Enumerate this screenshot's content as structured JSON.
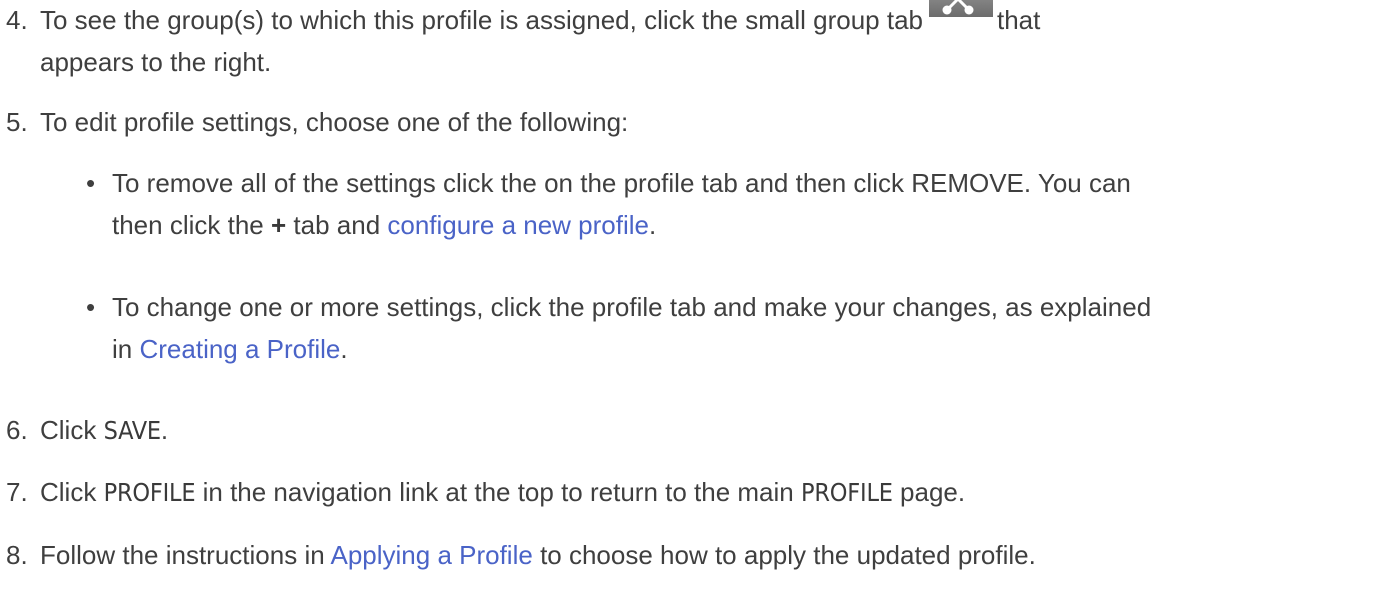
{
  "steps": {
    "s4": {
      "num": "4.",
      "pre": "To see the group(s) to which this profile is assigned, click the small group tab",
      "post": "that",
      "line2": "appears to the right."
    },
    "s5": {
      "num": "5.",
      "text": "To edit profile settings, choose one of the following:",
      "bullets": [
        {
          "dot": "•",
          "pre": "To remove all of the settings click the on the profile tab and then click REMOVE. You can",
          "line2_pre": "then click the",
          "plus": "+",
          "line2_mid": "tab and",
          "link": "configure a new profile",
          "line2_post": "."
        },
        {
          "dot": "•",
          "pre": "To change one or more settings, click the profile tab and make your changes, as explained",
          "line2_pre": "in",
          "link": "Creating a Profile",
          "line2_post": "."
        }
      ]
    },
    "s6": {
      "num": "6.",
      "pre": "Click",
      "ui": "SAVE",
      "post": "."
    },
    "s7": {
      "num": "7.",
      "pre": "Click",
      "ui1": "PROFILE",
      "mid": "in the navigation link at the top to return to the main",
      "ui2": "PROFILE",
      "post": "page."
    },
    "s8": {
      "num": "8.",
      "pre": "Follow the instructions in",
      "link": "Applying a Profile",
      "post": "to choose how to apply the updated profile."
    }
  },
  "icons": {
    "group_tab": "group-tab-icon"
  },
  "colors": {
    "text": "#3f3f3f",
    "link": "#4a63c7",
    "tab": "#7a7a7a"
  }
}
